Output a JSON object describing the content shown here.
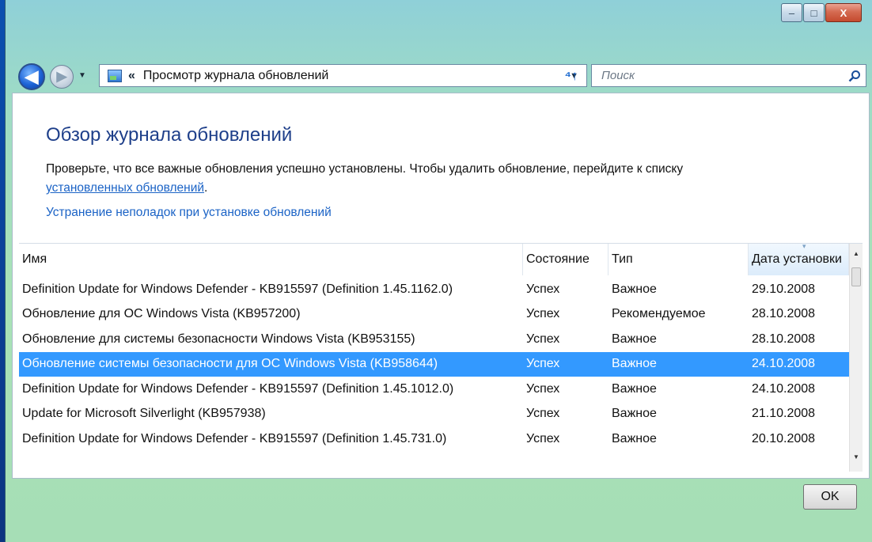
{
  "window": {
    "controls": {
      "minimize": "–",
      "maximize": "□",
      "close": "X"
    }
  },
  "nav": {
    "back_glyph": "◀",
    "forward_glyph": "▶",
    "dropdown_glyph": "▼"
  },
  "address": {
    "separator": "«",
    "path": "Просмотр журнала обновлений",
    "dropdown_glyph": "▼",
    "refresh_glyph": "⁴↑"
  },
  "search": {
    "placeholder": "Поиск"
  },
  "main": {
    "title": "Обзор журнала обновлений",
    "description": "Проверьте, что все важные обновления успешно установлены. Чтобы удалить обновление, перейдите к списку",
    "installed_link": "установленных обновлений",
    "description_end": ".",
    "troubleshoot_link": "Устранение неполадок при установке обновлений"
  },
  "table": {
    "columns": [
      "Имя",
      "Состояние",
      "Тип",
      "Дата установки"
    ],
    "sorted_column": "Дата установки",
    "sort_glyph": "▾",
    "rows": [
      {
        "name": "Definition Update for Windows Defender - KB915597 (Definition 1.45.1162.0)",
        "status": "Успех",
        "type": "Важное",
        "date": "29.10.2008"
      },
      {
        "name": "Обновление для ОС Windows Vista (KB957200)",
        "status": "Успех",
        "type": "Рекомендуемое",
        "date": "28.10.2008"
      },
      {
        "name": "Обновление для системы безопасности Windows Vista (KB953155)",
        "status": "Успех",
        "type": "Важное",
        "date": "28.10.2008"
      },
      {
        "name": "Обновление системы безопасности для ОС Windows Vista (KB958644)",
        "status": "Успех",
        "type": "Важное",
        "date": "24.10.2008",
        "selected": true
      },
      {
        "name": "Definition Update for Windows Defender - KB915597 (Definition 1.45.1012.0)",
        "status": "Успех",
        "type": "Важное",
        "date": "24.10.2008"
      },
      {
        "name": "Update for Microsoft Silverlight (KB957938)",
        "status": "Успех",
        "type": "Важное",
        "date": "21.10.2008"
      },
      {
        "name": "Definition Update for Windows Defender - KB915597 (Definition 1.45.731.0)",
        "status": "Успех",
        "type": "Важное",
        "date": "20.10.2008"
      }
    ],
    "scroll_up_glyph": "▲",
    "scroll_down_glyph": "▼"
  },
  "footer": {
    "ok_label": "OK"
  },
  "colors": {
    "selection": "#3399ff",
    "link": "#1b63c6",
    "title": "#1e3f8a",
    "desktop": "#0b4fb0"
  },
  "icons": [
    "back-icon",
    "forward-icon",
    "control-panel-icon",
    "refresh-icon",
    "search-icon",
    "minimize-icon",
    "maximize-icon",
    "close-icon"
  ]
}
